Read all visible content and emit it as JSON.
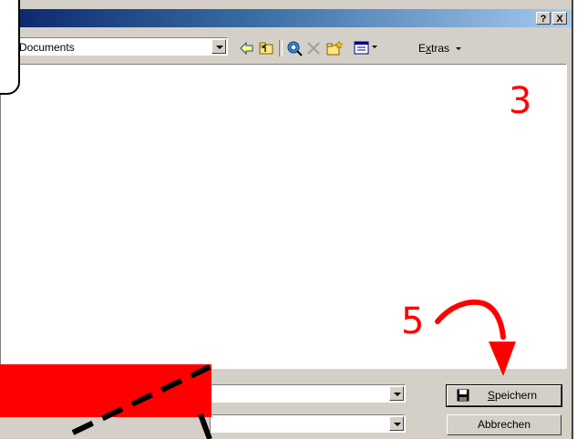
{
  "titlebar": {
    "help_label": "?",
    "close_label": "X"
  },
  "toolbar": {
    "location_value": "Documents",
    "extras_label_prefix": "E",
    "extras_label_accel": "x",
    "extras_label_rest": "tras"
  },
  "annotations": {
    "step3": "3",
    "step5": "5"
  },
  "buttons": {
    "save_accel": "S",
    "save_rest": "peichern",
    "cancel_label": "Abbrechen"
  },
  "colors": {
    "annotation": "#ff0000",
    "dialog_bg": "#d4d0c8",
    "title_start": "#0a246a",
    "title_end": "#a6caf0"
  }
}
